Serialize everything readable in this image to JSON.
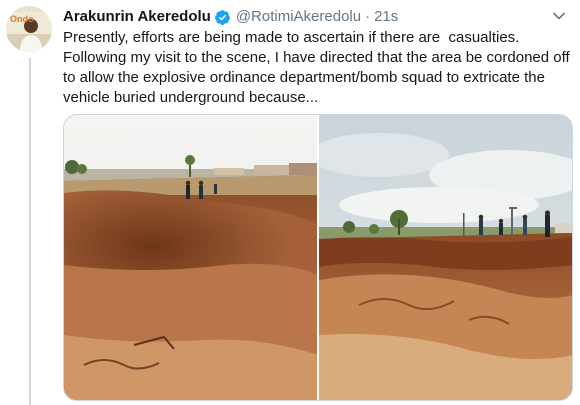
{
  "tweet": {
    "author": {
      "display_name": "Arakunrin Akeredolu",
      "handle": "@RotimiAkeredolu",
      "verified": true,
      "avatar_badge": "Ondo"
    },
    "separator": "·",
    "timestamp": "21s",
    "text": "Presently, efforts are being made to ascertain if there are  casualties.\nFollowing my visit to the scene, I have directed that the area be cordoned off\nto allow the explosive ordinance department/bomb squad to extricate the\nvehicle buried underground because...",
    "media": [
      {
        "type": "photo",
        "icon": "photo-left"
      },
      {
        "type": "photo",
        "icon": "photo-right"
      }
    ]
  },
  "icons": {
    "verified": "verified-badge-icon",
    "more": "chevron-down-icon"
  },
  "colors": {
    "name": "#14171a",
    "secondary": "#657786",
    "verified": "#1da1f2",
    "thread_line": "#ccd6dd"
  }
}
